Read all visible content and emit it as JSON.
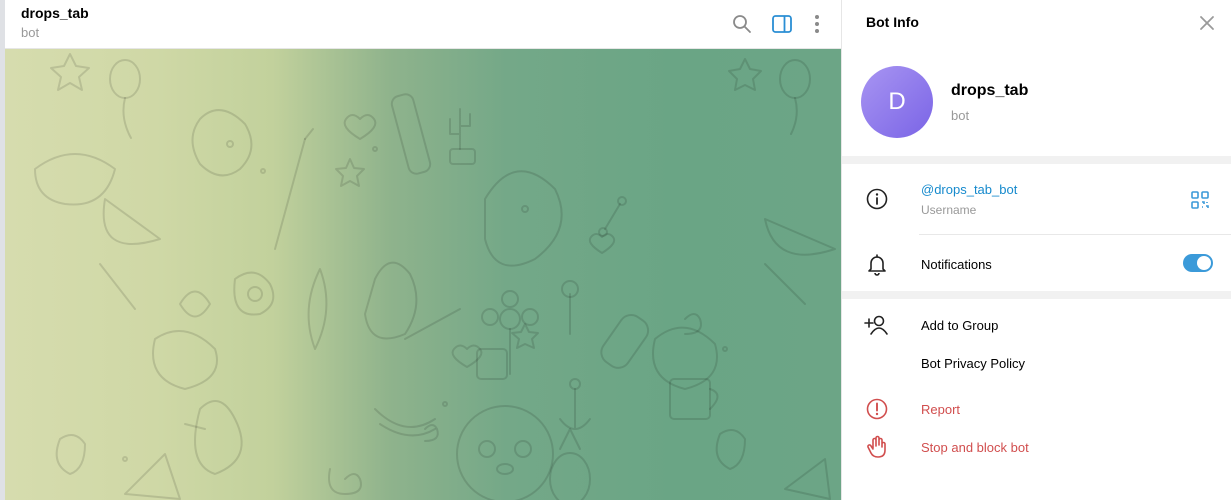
{
  "chat": {
    "title": "drops_tab",
    "subtitle": "bot",
    "header_icons": [
      "search-icon",
      "sidebar-panel-icon",
      "more-vertical-icon"
    ]
  },
  "info_panel": {
    "title": "Bot Info",
    "avatar_letter": "D",
    "name": "drops_tab",
    "subtitle": "bot",
    "username": "@drops_tab_bot",
    "username_caption": "Username",
    "notifications_label": "Notifications",
    "notifications_enabled": true,
    "actions": {
      "add_to_group": "Add to Group",
      "privacy_policy": "Bot Privacy Policy",
      "report": "Report",
      "stop_block": "Stop and block bot"
    }
  },
  "colors": {
    "accent": "#168acd",
    "toggle_on": "#3b9ad9",
    "danger": "#d14e4e",
    "avatar_start": "#a895f2",
    "avatar_end": "#7a64e6"
  }
}
